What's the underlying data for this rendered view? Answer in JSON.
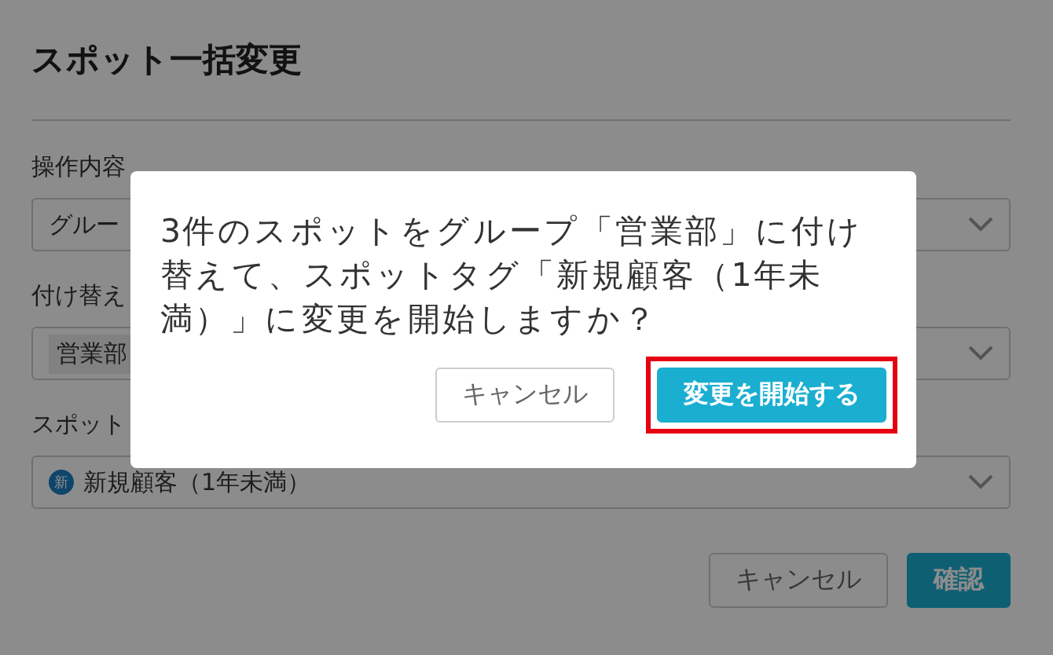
{
  "page": {
    "title": "スポット一括変更",
    "fields": [
      {
        "label": "操作内容",
        "value": "グルー",
        "kind": "plain"
      },
      {
        "label": "付け替え",
        "value": "営業部",
        "kind": "tag"
      },
      {
        "label": "スポット",
        "value": "新規顧客（1年未満）",
        "kind": "pin",
        "pin_text": "新"
      }
    ],
    "buttons": [
      {
        "label": "キャンセル",
        "primary": false
      },
      {
        "label": "確認",
        "primary": true
      }
    ]
  },
  "dialog": {
    "message": "3件のスポットをグループ「営業部」に付け替えて、スポットタグ「新規顧客（1年未満）」に変更を開始しますか？",
    "buttons": [
      {
        "label": "キャンセル",
        "primary": false,
        "highlighted": false
      },
      {
        "label": "変更を開始する",
        "primary": true,
        "highlighted": true
      }
    ]
  }
}
